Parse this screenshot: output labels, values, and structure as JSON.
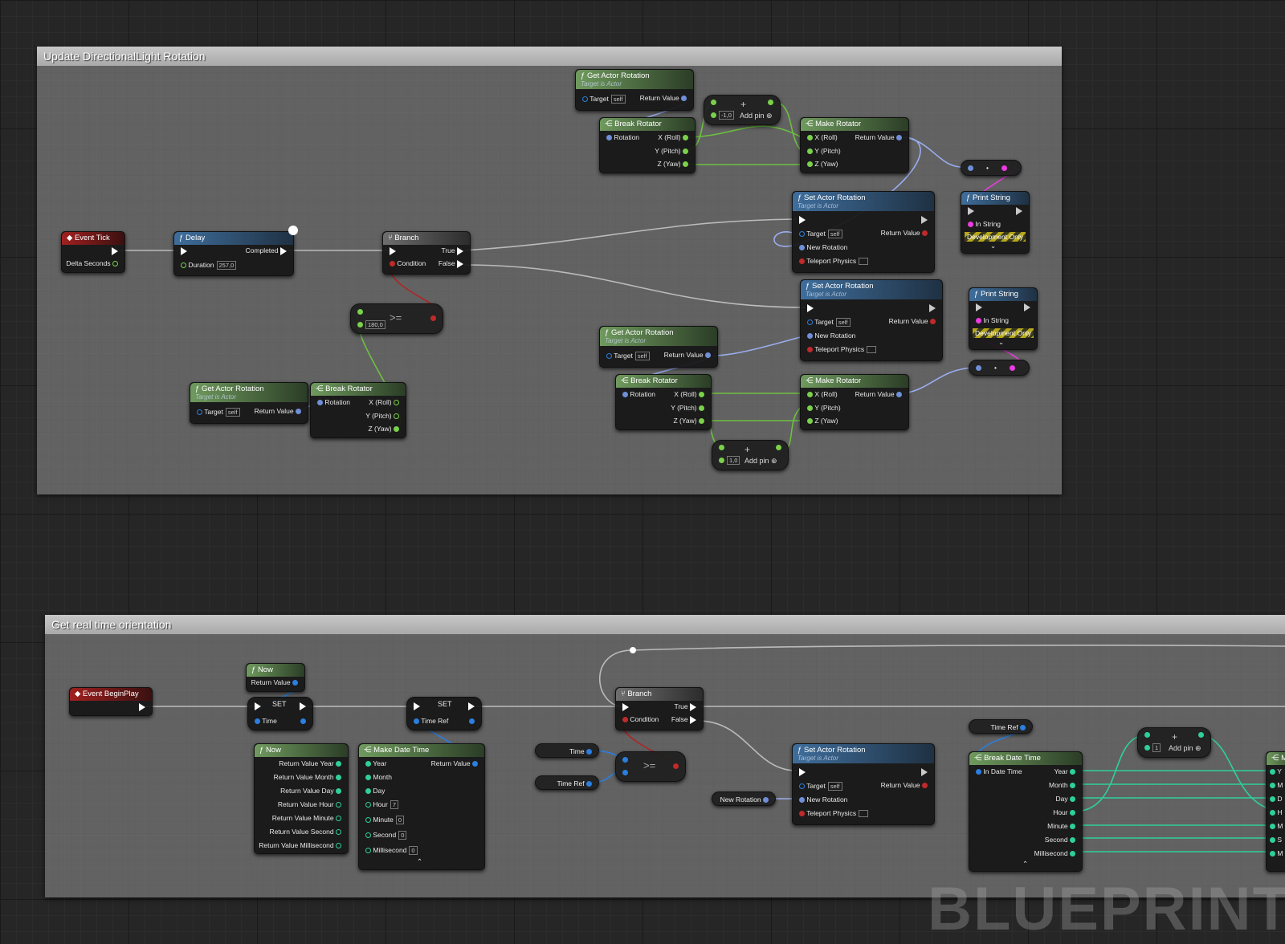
{
  "comments": {
    "top": "Update DirectionalLight Rotation",
    "bottom": "Get real time orientation"
  },
  "nodes": {
    "event_tick": {
      "title": "Event Tick",
      "delta": "Delta Seconds"
    },
    "delay": {
      "title": "Delay",
      "completed": "Completed",
      "duration": "Duration",
      "duration_value": "257,0"
    },
    "branch1": {
      "title": "Branch",
      "condition": "Condition",
      "true_label": "True",
      "false_label": "False"
    },
    "compare1": {
      "op": ">=",
      "value": "180,0"
    },
    "gar_top": {
      "title": "Get Actor Rotation",
      "sub": "Target is Actor",
      "target": "Target",
      "self": "self",
      "ret": "Return Value"
    },
    "gar_left": {
      "title": "Get Actor Rotation",
      "sub": "Target is Actor",
      "target": "Target",
      "self": "self",
      "ret": "Return Value"
    },
    "gar_mid": {
      "title": "Get Actor Rotation",
      "sub": "Target is Actor",
      "target": "Target",
      "self": "self",
      "ret": "Return Value"
    },
    "break_top": {
      "title": "Break Rotator",
      "rotation": "Rotation",
      "x": "X (Roll)",
      "y": "Y (Pitch)",
      "z": "Z (Yaw)"
    },
    "break_left": {
      "title": "Break Rotator",
      "rotation": "Rotation",
      "x": "X (Roll)",
      "y": "Y (Pitch)",
      "z": "Z (Yaw)"
    },
    "break_mid": {
      "title": "Break Rotator",
      "rotation": "Rotation",
      "x": "X (Roll)",
      "y": "Y (Pitch)",
      "z": "Z (Yaw)"
    },
    "add_top": {
      "value": "-1,0",
      "add": "Add pin"
    },
    "add_mid": {
      "value": "1,0",
      "add": "Add pin"
    },
    "make_top": {
      "title": "Make Rotator",
      "x": "X (Roll)",
      "y": "Y (Pitch)",
      "z": "Z (Yaw)",
      "ret": "Return Value"
    },
    "make_mid": {
      "title": "Make Rotator",
      "x": "X (Roll)",
      "y": "Y (Pitch)",
      "z": "Z (Yaw)",
      "ret": "Return Value"
    },
    "set_rot1": {
      "title": "Set Actor Rotation",
      "sub": "Target is Actor",
      "target": "Target",
      "self": "self",
      "ret": "Return Value",
      "new_rot": "New Rotation",
      "teleport": "Teleport Physics"
    },
    "set_rot2": {
      "title": "Set Actor Rotation",
      "sub": "Target is Actor",
      "target": "Target",
      "self": "self",
      "ret": "Return Value",
      "new_rot": "New Rotation",
      "teleport": "Teleport Physics"
    },
    "set_rot3": {
      "title": "Set Actor Rotation",
      "sub": "Target is Actor",
      "target": "Target",
      "self": "self",
      "ret": "Return Value",
      "new_rot": "New Rotation",
      "teleport": "Teleport Physics"
    },
    "print1": {
      "title": "Print String",
      "in": "In String",
      "dev": "Development Only"
    },
    "print2": {
      "title": "Print String",
      "in": "In String",
      "dev": "Development Only"
    },
    "event_begin": {
      "title": "Event BeginPlay"
    },
    "now_small": {
      "title": "Now",
      "ret": "Return Value"
    },
    "set_time": {
      "title": "SET",
      "var": "Time"
    },
    "set_timeref": {
      "title": "SET",
      "var": "Time Ref"
    },
    "now_big": {
      "title": "Now",
      "pins": [
        "Return Value Year",
        "Return Value Month",
        "Return Value Day",
        "Return Value Hour",
        "Return Value Minute",
        "Return Value Second",
        "Return Value Millisecond"
      ]
    },
    "make_dt": {
      "title": "Make Date Time",
      "ret": "Return Value",
      "pins": [
        "Year",
        "Month",
        "Day",
        "Hour",
        "Minute",
        "Second",
        "Millisecond"
      ],
      "hour_val": "7",
      "minute_val": "0",
      "second_val": "0",
      "ms_val": "0"
    },
    "time_var": {
      "label": "Time"
    },
    "timeref_var": {
      "label": "Time Ref"
    },
    "timeref_var2": {
      "label": "Time Ref"
    },
    "compare2": {
      "op": ">="
    },
    "branch2": {
      "title": "Branch",
      "condition": "Condition",
      "true_label": "True",
      "false_label": "False"
    },
    "newrot_var": {
      "label": "New Rotation"
    },
    "break_dt": {
      "title": "Break Date Time",
      "in": "In Date Time",
      "pins": [
        "Year",
        "Month",
        "Day",
        "Hour",
        "Minute",
        "Second",
        "Millisecond"
      ]
    },
    "add_bottom": {
      "value": "1",
      "add": "Add pin"
    },
    "partial_right": {
      "pins": [
        "Y",
        "M",
        "D",
        "H",
        "M",
        "S",
        "M"
      ]
    }
  },
  "watermark": "BLUEPRINT",
  "colors": {
    "exec": "#ffffff",
    "float": "#7ad14a",
    "rotator": "#9aaef0",
    "object": "#2a7fe0",
    "bool": "#c02a2a",
    "string": "#ea3de0",
    "int": "#2fcf9c"
  }
}
